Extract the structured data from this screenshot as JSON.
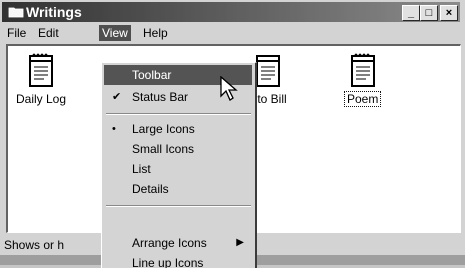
{
  "window": {
    "title": "Writings",
    "controls": {
      "minimize": "_",
      "maximize": "□",
      "close": "×"
    }
  },
  "menubar": {
    "items": [
      "File",
      "Edit",
      "View",
      "Help"
    ]
  },
  "files": [
    "Daily Log",
    "r to Bill",
    "Poem"
  ],
  "view_menu": {
    "items": [
      {
        "label": "Toolbar",
        "state": "highlighted"
      },
      {
        "label": "Status Bar",
        "mark": "✔"
      },
      {
        "label": "Large Icons",
        "mark": "•"
      },
      {
        "label": "Small Icons"
      },
      {
        "label": "List"
      },
      {
        "label": "Details"
      },
      {
        "label": "Arrange Icons",
        "arrow": "▶"
      },
      {
        "label": "Line up Icons"
      }
    ]
  },
  "statusbar": {
    "text": "Shows or h"
  },
  "colors": {
    "highlight": "#5a5a5a",
    "face": "#c8c8c8",
    "titlebar": "#3c3c3c"
  }
}
